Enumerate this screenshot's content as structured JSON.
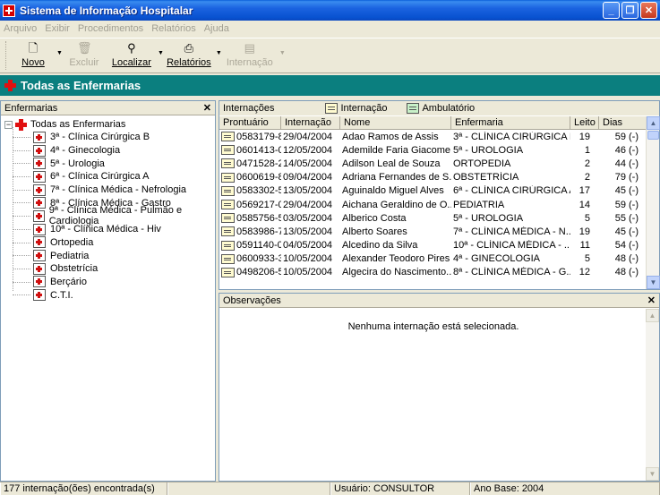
{
  "window": {
    "title": "Sistema de Informação Hospitalar"
  },
  "menu": [
    "Arquivo",
    "Exibir",
    "Procedimentos",
    "Relatórios",
    "Ajuda"
  ],
  "toolbar": {
    "novo": "Novo",
    "excluir": "Excluir",
    "localizar": "Localizar",
    "relatorios": "Relatórios",
    "internacao": "Internação"
  },
  "header": {
    "title": "Todas as Enfermarias"
  },
  "left_panel": {
    "title": "Enfermarias",
    "root": "Todas as Enfermarias",
    "items": [
      "3ª - Clínica Cirúrgica B",
      "4ª - Ginecologia",
      "5ª - Urologia",
      "6ª - Clínica Cirúrgica A",
      "7ª - Clínica Médica - Nefrologia",
      "8ª - Clínica Médica - Gastro",
      "9ª - Clínica Médica - Pulmão e Cardiologia",
      "10ª - Clínica Médica - Hiv",
      "Ortopedia",
      "Pediatria",
      "Obstetrícia",
      "Berçário",
      "C.T.I."
    ]
  },
  "internacoes": {
    "title": "Internações",
    "tab_internacao": "Internação",
    "tab_ambulatorio": "Ambulatório",
    "columns": [
      "Prontuário",
      "Internação",
      "Nome",
      "Enfermaria",
      "Leito",
      "Dias"
    ],
    "rows": [
      [
        "0583179-8",
        "29/04/2004",
        "Adao Ramos de Assis",
        "3ª - CLÍNICA CIRÚRGICA B",
        "19",
        "59 (-)"
      ],
      [
        "0601413-0",
        "12/05/2004",
        "Ademilde Faria Giacome...",
        "5ª - UROLOGIA",
        "1",
        "46 (-)"
      ],
      [
        "0471528-2",
        "14/05/2004",
        "Adilson Leal de Souza",
        "ORTOPEDIA",
        "2",
        "44 (-)"
      ],
      [
        "0600619-8",
        "09/04/2004",
        "Adriana Fernandes de S...",
        "OBSTETRÍCIA",
        "2",
        "79 (-)"
      ],
      [
        "0583302-5",
        "13/05/2004",
        "Aguinaldo Miguel Alves",
        "6ª - CLÍNICA CIRÚRGICA A",
        "17",
        "45 (-)"
      ],
      [
        "0569217-0",
        "29/04/2004",
        "Aichana Geraldino de O...",
        "PEDIATRIA",
        "14",
        "59 (-)"
      ],
      [
        "0585756-5",
        "03/05/2004",
        "Alberico Costa",
        "5ª - UROLOGIA",
        "5",
        "55 (-)"
      ],
      [
        "0583986-7",
        "13/05/2004",
        "Alberto Soares",
        "7ª - CLÍNICA MÉDICA - N...",
        "19",
        "45 (-)"
      ],
      [
        "0591140-0",
        "04/05/2004",
        "Alcedino da Silva",
        "10ª - CLÍNICA MÉDICA - ...",
        "11",
        "54 (-)"
      ],
      [
        "0600933-3",
        "10/05/2004",
        "Alexander Teodoro Pires",
        "4ª - GINECOLOGIA",
        "5",
        "48 (-)"
      ],
      [
        "0498206-5",
        "10/05/2004",
        "Algecira do Nascimento...",
        "8ª - CLÍNICA MÉDICA - G...",
        "12",
        "48 (-)"
      ]
    ]
  },
  "observacoes": {
    "title": "Observações",
    "message": "Nenhuma internação está selecionada."
  },
  "status": {
    "count": "177 internação(ões) encontrada(s)",
    "usuario": "Usuário: CONSULTOR",
    "ano_base": "Ano Base: 2004"
  }
}
